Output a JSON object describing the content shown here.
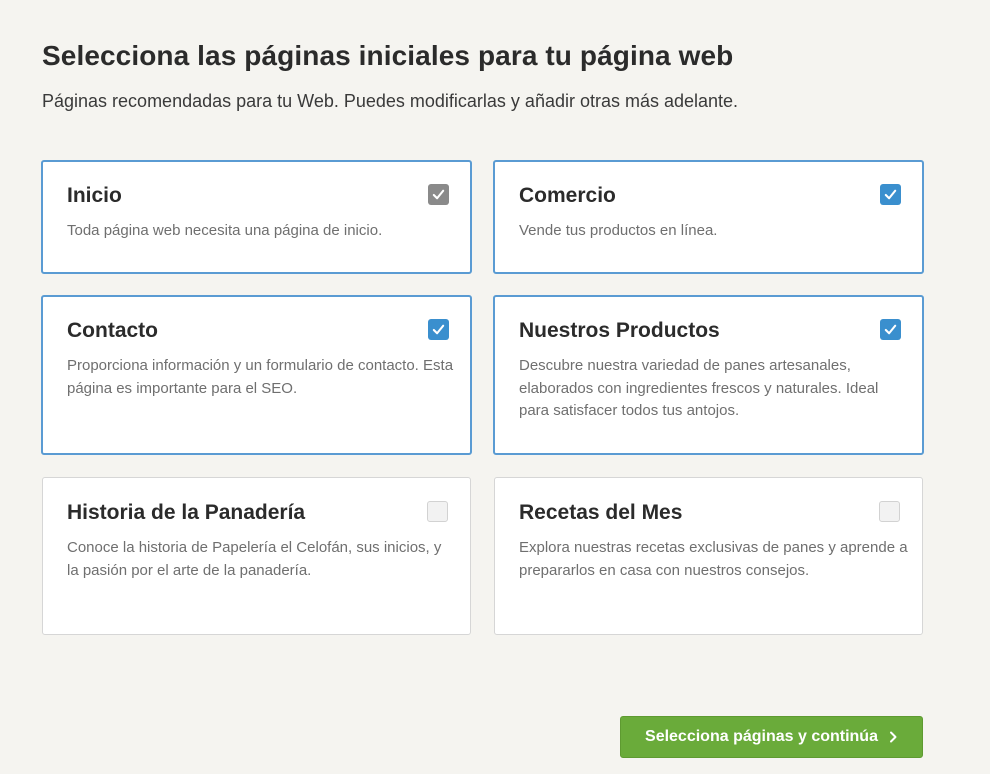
{
  "header": {
    "title": "Selecciona las páginas iniciales para tu página web",
    "subtitle": "Páginas recomendadas para tu Web. Puedes modificarlas y añadir otras más adelante."
  },
  "cards": [
    {
      "title": "Inicio",
      "description": "Toda página web necesita una página de inicio.",
      "checked": true,
      "locked": true
    },
    {
      "title": "Comercio",
      "description": "Vende tus productos en línea.",
      "checked": true,
      "locked": false
    },
    {
      "title": "Contacto",
      "description": "Proporciona información y un formulario de contacto. Esta página es importante para el SEO.",
      "checked": true,
      "locked": false
    },
    {
      "title": "Nuestros Productos",
      "description": "Descubre nuestra variedad de panes artesanales, elaborados con ingredientes frescos y naturales. Ideal para satisfacer todos tus antojos.",
      "checked": true,
      "locked": false
    },
    {
      "title": "Historia de la Panadería",
      "description": "Conoce la historia de Papelería el Celofán, sus inicios, y la pasión por el arte de la panadería.",
      "checked": false,
      "locked": false
    },
    {
      "title": "Recetas del Mes",
      "description": "Explora nuestras recetas exclusivas de panes y aprende a prepararlos en casa con nuestros consejos.",
      "checked": false,
      "locked": false
    }
  ],
  "footer": {
    "continue_label": "Selecciona páginas y continúa"
  },
  "colors": {
    "background": "#f5f4f0",
    "selected_border": "#5a9bd3",
    "checkbox_checked": "#3a8fce",
    "checkbox_locked": "#8a8a8a",
    "continue_button": "#6aab3a"
  }
}
